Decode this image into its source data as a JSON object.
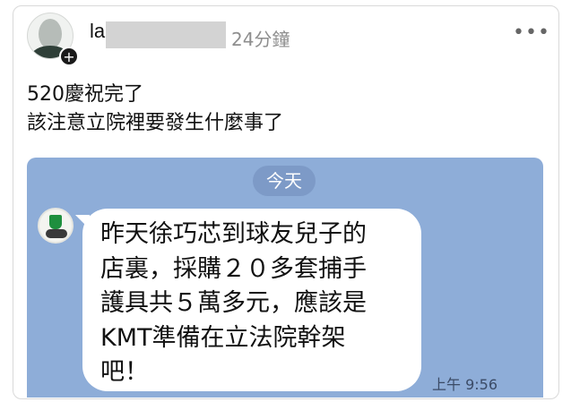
{
  "post": {
    "author_name_visible": "la",
    "time": "24分鐘",
    "more_label": "•••",
    "text": "520慶祝完了\n該注意立院裡要發生什麼事了"
  },
  "avatar_badge": "+",
  "chat_screenshot": {
    "date_label": "今天",
    "message": "昨天徐巧芯到球友兒子的\n店裏，採購２０多套捕手\n護具共５萬多元，應該是\nKMT準備在立法院幹架\n吧！",
    "message_time": "上午 9:56"
  },
  "colors": {
    "chat_background": "#8eadd8",
    "date_pill": "#7d9ac7",
    "bubble": "#ffffff"
  }
}
